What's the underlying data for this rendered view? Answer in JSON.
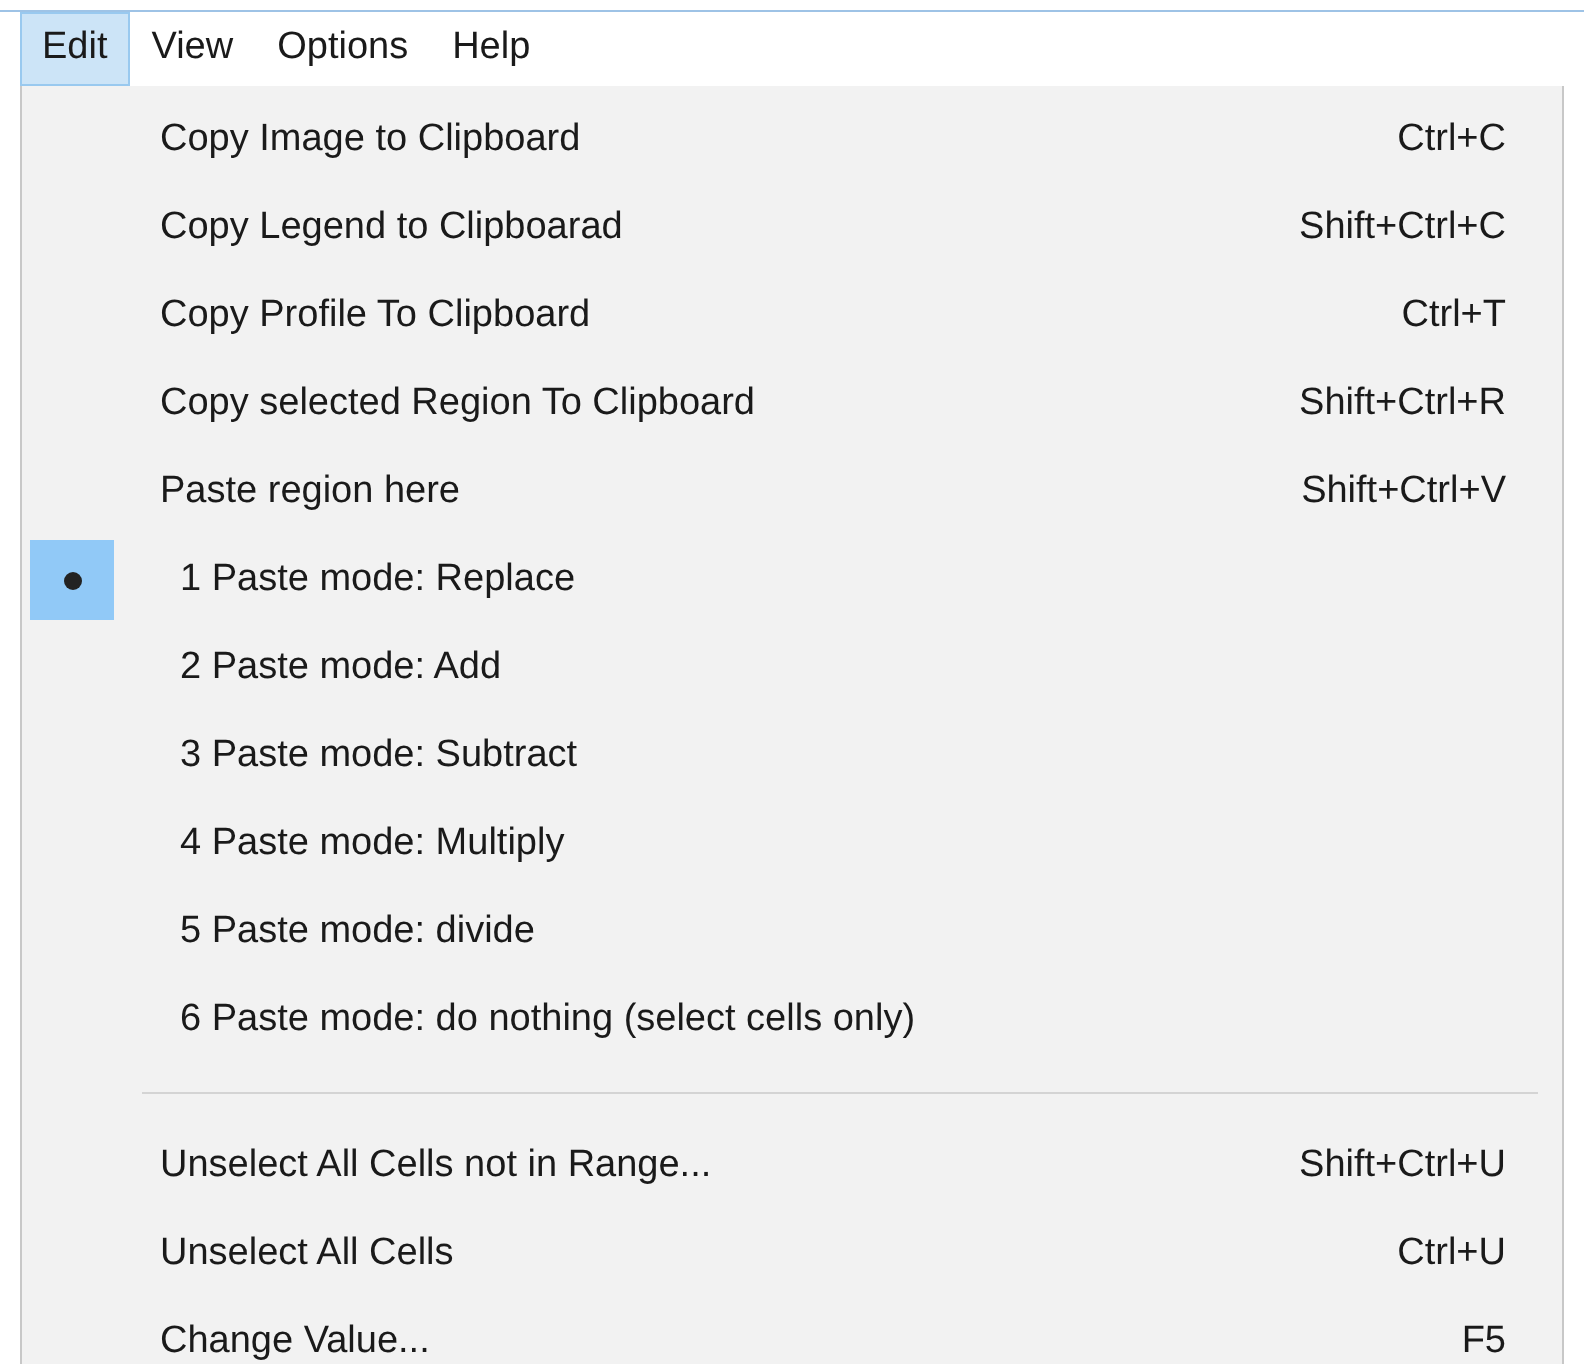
{
  "menu_bar": [
    {
      "label": "Edit",
      "selected": true
    },
    {
      "label": "View",
      "selected": false
    },
    {
      "label": "Options",
      "selected": false
    },
    {
      "label": "Help",
      "selected": false
    }
  ],
  "menu": {
    "items": [
      {
        "kind": "command",
        "label": "Copy Image to Clipboard",
        "shortcut": "Ctrl+C"
      },
      {
        "kind": "command",
        "label": "Copy Legend to Clipboarad",
        "shortcut": "Shift+Ctrl+C"
      },
      {
        "kind": "command",
        "label": "Copy Profile To Clipboard",
        "shortcut": "Ctrl+T"
      },
      {
        "kind": "command",
        "label": "Copy selected Region To Clipboard",
        "shortcut": "Shift+Ctrl+R"
      },
      {
        "kind": "command",
        "label": "Paste region here",
        "shortcut": "Shift+Ctrl+V"
      },
      {
        "kind": "radio",
        "label": "1 Paste mode: Replace",
        "selected": true
      },
      {
        "kind": "radio",
        "label": "2 Paste mode: Add",
        "selected": false
      },
      {
        "kind": "radio",
        "label": "3 Paste mode: Subtract",
        "selected": false
      },
      {
        "kind": "radio",
        "label": "4 Paste mode: Multiply",
        "selected": false
      },
      {
        "kind": "radio",
        "label": "5 Paste mode: divide",
        "selected": false
      },
      {
        "kind": "radio",
        "label": "6 Paste mode: do nothing (select cells only)",
        "selected": false
      },
      {
        "kind": "separator"
      },
      {
        "kind": "command",
        "label": "Unselect All Cells not in Range...",
        "shortcut": "Shift+Ctrl+U"
      },
      {
        "kind": "command",
        "label": "Unselect All Cells",
        "shortcut": "Ctrl+U"
      },
      {
        "kind": "command",
        "label": "Change Value...",
        "shortcut": "F5"
      }
    ]
  }
}
